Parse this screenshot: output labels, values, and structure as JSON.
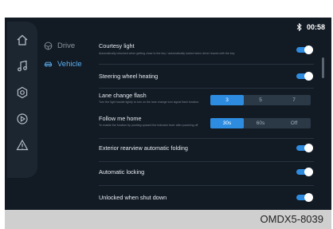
{
  "status": {
    "bluetooth_icon": "bluetooth-icon",
    "time": "00:58"
  },
  "sidebar_icons": [
    "home-icon",
    "music-icon",
    "settings-gear-icon",
    "play-circle-icon",
    "warning-triangle-icon"
  ],
  "nav": {
    "drive": "Drive",
    "vehicle": "Vehicle",
    "active": "Vehicle"
  },
  "settings": {
    "courtesy_light": {
      "title": "Courtesy light",
      "desc": "Automatically unlocked when getting close to the key / automatically locked when driver leaves with the key",
      "enabled": true
    },
    "steering_wheel_heating": {
      "title": "Steering wheel heating",
      "enabled": true
    },
    "lane_change_flash": {
      "title": "Lane change flash",
      "desc": "Turn the light handle lightly to turn on the lane change turn signal flash function",
      "options": [
        "3",
        "5",
        "7"
      ],
      "selected": "3"
    },
    "follow_me_home": {
      "title": "Follow me home",
      "desc": "To enable the function by pushing upward the indicator lever after powering off",
      "options": [
        "30s",
        "60s",
        "Off"
      ],
      "selected": "30s"
    },
    "exterior_mirror_folding": {
      "title": "Exterior rearview automatic folding",
      "enabled": true
    },
    "automatic_locking": {
      "title": "Automatic locking",
      "enabled": true
    },
    "unlocked_when_shut_down": {
      "title": "Unlocked when shut down",
      "enabled": true
    }
  },
  "caption": "OMDX5-8039",
  "colors": {
    "screen_bg": "#121a24",
    "accent": "#2e8ce0",
    "active_nav": "#5cb0f0"
  }
}
